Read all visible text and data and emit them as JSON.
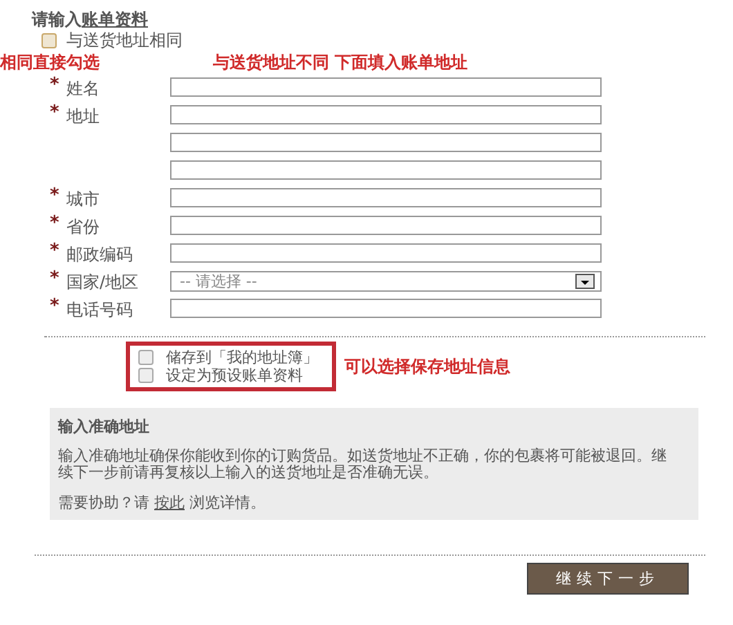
{
  "heading": {
    "prefix": "请输入",
    "link": "账单资料"
  },
  "same_as_shipping": {
    "label": "与送货地址相同",
    "checked": false
  },
  "annotations": [
    "相同直接勾选",
    "与送货地址不同 下面填入账单地址",
    "可以选择保存地址信息"
  ],
  "fields": [
    {
      "kind": "text",
      "label": "姓名",
      "required": true
    },
    {
      "kind": "text",
      "label": "地址",
      "required": true
    },
    {
      "kind": "text",
      "required": false
    },
    {
      "kind": "text",
      "required": false
    },
    {
      "kind": "text",
      "label": "城市",
      "required": true
    },
    {
      "kind": "text",
      "label": "省份",
      "required": true
    },
    {
      "kind": "text",
      "label": "邮政编码",
      "required": true
    },
    {
      "kind": "select",
      "label": "国家/地区",
      "required": true,
      "value": "-- 请选择 --"
    },
    {
      "kind": "text",
      "label": "电话号码",
      "required": true
    }
  ],
  "required_mark": "*",
  "save_options": [
    {
      "label": "储存到「我的地址簿」",
      "checked": false
    },
    {
      "label": "设定为预设账单资料",
      "checked": false
    }
  ],
  "notice": {
    "title": "输入准确地址",
    "body": "输入准确地址确保你能收到你的订购货品。如送货地址不正确，你的包裹将可能被退回。继续下一步前请再复核以上输入的送货地址是否准确无误。",
    "help_before": "需要协助？请",
    "help_link": "按此",
    "help_after": "浏览详情。"
  },
  "continue_button": "继续下一步"
}
